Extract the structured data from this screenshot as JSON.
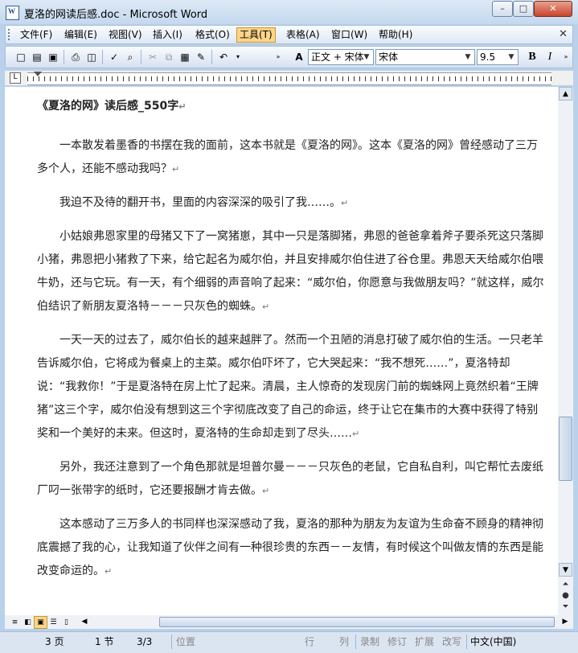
{
  "window": {
    "title": "夏洛的网读后感.doc - Microsoft Word",
    "app_icon_letter": "W",
    "min_glyph": "–",
    "max_glyph": "□",
    "close_glyph": "✕"
  },
  "menubar": {
    "items": [
      "文件(F)",
      "编辑(E)",
      "视图(V)",
      "插入(I)",
      "格式(O)",
      "工具(T)",
      "表格(A)",
      "窗口(W)",
      "帮助(H)"
    ],
    "active_index": 5,
    "close_doc_glyph": "✕"
  },
  "toolbar": {
    "style_value": "正文 + 宋体",
    "font_value": "宋体",
    "size_value": "9.5",
    "bold_label": "B",
    "italic_label": "I",
    "undo_glyph": "↶",
    "style_pane_label": "A"
  },
  "ruler": {
    "tab_selector_glyph": "L"
  },
  "document": {
    "heading": "《夏洛的网》读后感_550字",
    "paragraphs": [
      "一本散发着墨香的书摆在我的面前，这本书就是《夏洛的网》。这本《夏洛的网》曾经感动了三万多个人，还能不感动我吗？",
      "我迫不及待的翻开书，里面的内容深深的吸引了我……。",
      "小姑娘弗恩家里的母猪又下了一窝猪崽，其中一只是落脚猪，弗恩的爸爸拿着斧子要杀死这只落脚小猪，弗恩把小猪救了下来，给它起名为威尔伯，并且安排威尔伯住进了谷仓里。弗恩天天给威尔伯喂牛奶，还与它玩。有一天，有个细弱的声音响了起来：“威尔伯，你愿意与我做朋友吗？”就这样，威尔伯结识了新朋友夏洛特－－－只灰色的蜘蛛。",
      "一天一天的过去了，威尔伯长的越来越胖了。然而一个丑陋的消息打破了威尔伯的生活。一只老羊告诉威尔伯，它将成为餐桌上的主菜。威尔伯吓坏了，它大哭起来：“我不想死……”，夏洛特却说：“我救你！”于是夏洛特在房上忙了起来。清晨，主人惊奇的发现房门前的蜘蛛网上竟然织着“王牌猪”这三个字，威尔伯没有想到这三个字彻底改变了自己的命运，终于让它在集市的大赛中获得了特别奖和一个美好的未来。但这时，夏洛特的生命却走到了尽头……",
      "另外，我还注意到了一个角色那就是坦普尔曼－－－只灰色的老鼠，它自私自利，叫它帮忙去废纸厂叼一张带字的纸时，它还要报酬才肯去做。",
      "这本感动了三万多人的书同样也深深感动了我，夏洛的那种为朋友为友谊为生命奋不顾身的精神彻底震撼了我的心，让我知道了伙伴之间有一种很珍贵的东西－－友情，有时候这个叫做友情的东西是能改变命运的。"
    ],
    "paragraph_mark": "↵"
  },
  "statusbar": {
    "page": "3 页",
    "section": "1 节",
    "page_of": "3/3",
    "position": "位置",
    "line": "行",
    "column": "列",
    "rec": "录制",
    "trk": "修订",
    "ext": "扩展",
    "ovr": "改写",
    "language": "中文(中国)"
  },
  "colors": {
    "title_bar": "#c4d8ee",
    "menu_active": "#ffd589",
    "document_bg": "#ffffff"
  }
}
